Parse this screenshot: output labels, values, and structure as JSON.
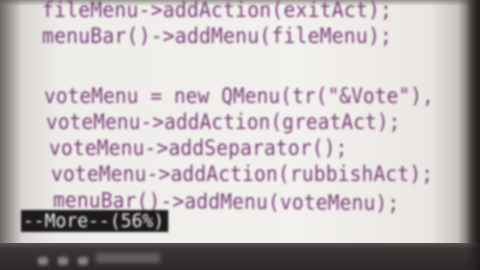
{
  "terminal": {
    "lines": [
      "fileMenu->addAction(exitAct);",
      "menuBar()->addMenu(fileMenu);",
      "voteMenu = new QMenu(tr(\"&Vote\"),",
      "voteMenu->addAction(greatAct);",
      "voteMenu->addSeparator();",
      "voteMenu->addAction(rubbishAct);",
      "menuBar()->addMenu(voteMenu);"
    ],
    "pager_status": "--More--(56%)"
  },
  "colors": {
    "code_text": "#7a3f78",
    "background": "#f3f1ee",
    "pager_bg": "#1c1a1b",
    "pager_text": "#f3f0ee"
  }
}
